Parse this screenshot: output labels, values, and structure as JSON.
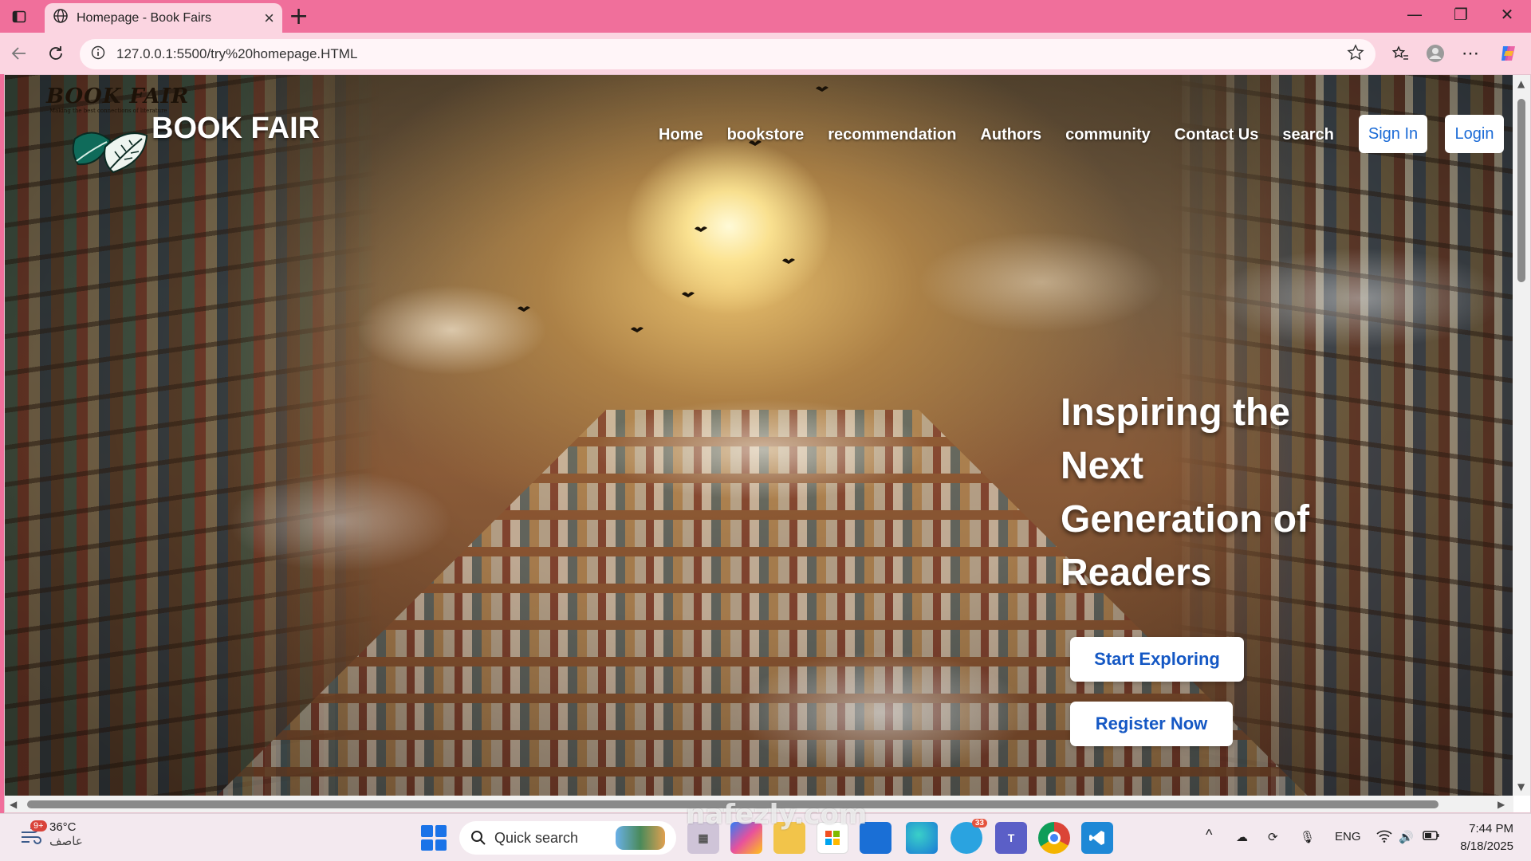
{
  "browser": {
    "tab_title": "Homepage - Book Fairs",
    "url": "127.0.0.1:5500/try%20homepage.HTML"
  },
  "site": {
    "script_logo": "BOOK FAIR",
    "script_tagline": "Making the best connections of literature",
    "brand": "BOOK FAIR",
    "nav": [
      "Home",
      "bookstore",
      "recommendation",
      "Authors",
      "community",
      "Contact Us",
      "search"
    ],
    "sign_in": "Sign In",
    "login": "Login",
    "headline_lines": [
      "Inspiring the",
      "Next",
      "Generation of",
      "Readers"
    ],
    "cta_primary": "Start Exploring",
    "cta_secondary": "Register Now"
  },
  "taskbar": {
    "weather_temp": "36°C",
    "weather_condition": "عاصف",
    "notification_badge": "9+",
    "search_label": "Quick search",
    "telegram_badge": "33",
    "language": "ENG",
    "time": "7:44 PM",
    "date": "8/18/2025"
  },
  "watermark": "nafezly.com",
  "colors": {
    "tab_strip": "#f06f9b",
    "toolbar": "#fbd5e1",
    "button_text": "#1b6bd6",
    "cta_text": "#1558c4"
  }
}
